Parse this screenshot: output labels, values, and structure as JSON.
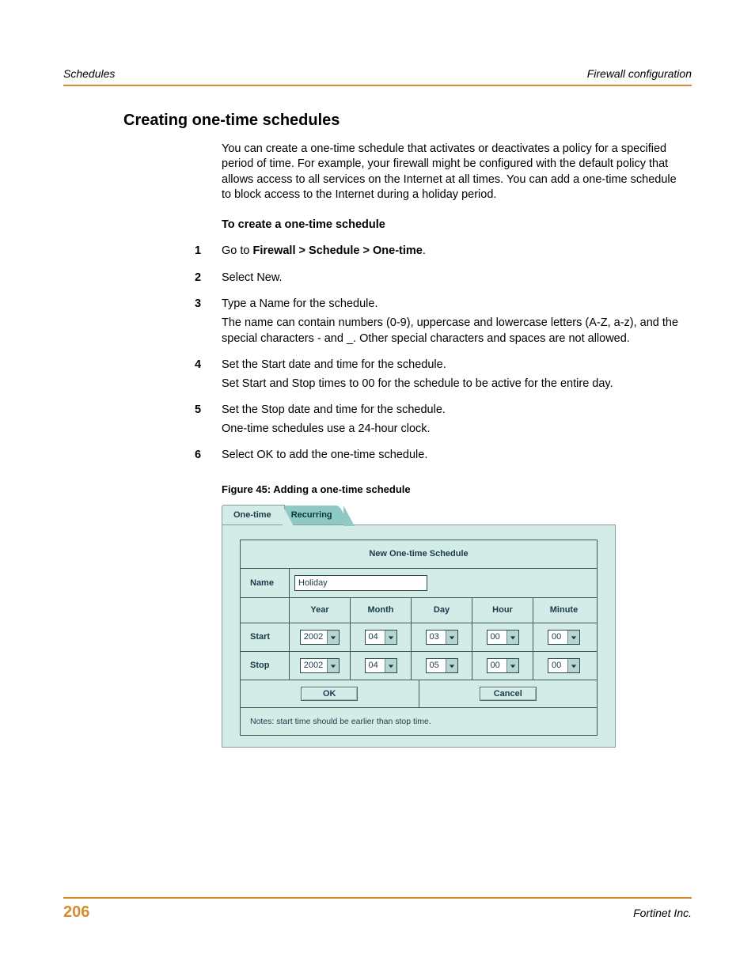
{
  "header": {
    "left": "Schedules",
    "right": "Firewall configuration"
  },
  "title": "Creating one-time schedules",
  "lead": "You can create a one-time schedule that activates or deactivates a policy for a specified period of time. For example, your firewall might be configured with the default policy that allows access to all services on the Internet at all times. You can add a one-time schedule to block access to the Internet during a holiday period.",
  "subhead": "To create a one-time schedule",
  "steps": [
    {
      "num": "1",
      "lines": [
        {
          "pre": "Go to ",
          "bold": "Firewall > Schedule > One-time",
          "post": "."
        }
      ]
    },
    {
      "num": "2",
      "lines": [
        {
          "text": "Select New."
        }
      ]
    },
    {
      "num": "3",
      "lines": [
        {
          "text": "Type a Name for the schedule."
        },
        {
          "text": "The name can contain numbers (0-9), uppercase and lowercase letters (A-Z, a-z), and the special characters - and _. Other special characters and spaces are not allowed."
        }
      ]
    },
    {
      "num": "4",
      "lines": [
        {
          "text": "Set the Start date and time for the schedule."
        },
        {
          "text": "Set Start and Stop times to 00 for the schedule to be active for the entire day."
        }
      ]
    },
    {
      "num": "5",
      "lines": [
        {
          "text": "Set the Stop date and time for the schedule."
        },
        {
          "text": "One-time schedules use a 24-hour clock."
        }
      ]
    },
    {
      "num": "6",
      "lines": [
        {
          "text": "Select OK to add the one-time schedule."
        }
      ]
    }
  ],
  "figure_caption": "Figure 45: Adding a one-time schedule",
  "ui": {
    "tabs": [
      "One-time",
      "Recurring"
    ],
    "panel_title": "New One-time Schedule",
    "name_label": "Name",
    "name_value": "Holiday",
    "cols": [
      "Year",
      "Month",
      "Day",
      "Hour",
      "Minute"
    ],
    "rows": [
      {
        "label": "Start",
        "vals": [
          "2002",
          "04",
          "03",
          "00",
          "00"
        ]
      },
      {
        "label": "Stop",
        "vals": [
          "2002",
          "04",
          "05",
          "00",
          "00"
        ]
      }
    ],
    "ok": "OK",
    "cancel": "Cancel",
    "notes": "Notes: start time should be earlier than stop time."
  },
  "footer": {
    "page": "206",
    "company": "Fortinet Inc."
  }
}
